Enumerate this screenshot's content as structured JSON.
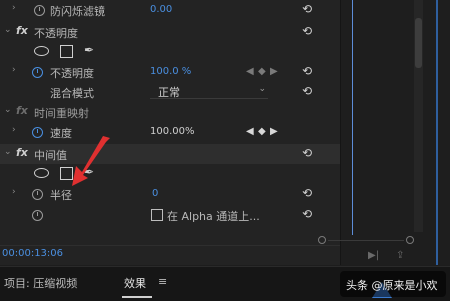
{
  "effects": {
    "rows": [
      {
        "label": "防闪烁滤镜",
        "value": "0.00"
      },
      {
        "label": "不透明度"
      },
      {
        "label": "不透明度",
        "value": "100.0 %"
      },
      {
        "label": "混合模式",
        "value": "正常"
      },
      {
        "label": "时间重映射"
      },
      {
        "label": "速度",
        "value": "100.00%"
      },
      {
        "label": "中间值"
      },
      {
        "label": "半径",
        "value": "0"
      },
      {
        "label": "在 Alpha 通道上..."
      }
    ],
    "fx": "fx",
    "reset_glyph": "⟲",
    "keyframe_prev": "◀",
    "keyframe_add": "◆",
    "keyframe_next": "▶"
  },
  "timecode": "00:00:13:06",
  "footer_icons": [
    "▶|",
    "⇪"
  ],
  "tabs": {
    "project": "项目: 压缩视频",
    "effects": "效果",
    "menu": "≡"
  },
  "watermark": "头条 @原来是小欢",
  "icons": {
    "reset": "reset-icon",
    "stopwatch": "stopwatch-icon",
    "pen": "pen-icon",
    "ellipse": "ellipse-mask-icon",
    "rect": "rectangle-mask-icon"
  },
  "colors": {
    "accent": "#4a8fe0",
    "arrow": "#e03030",
    "background": "#232323"
  }
}
